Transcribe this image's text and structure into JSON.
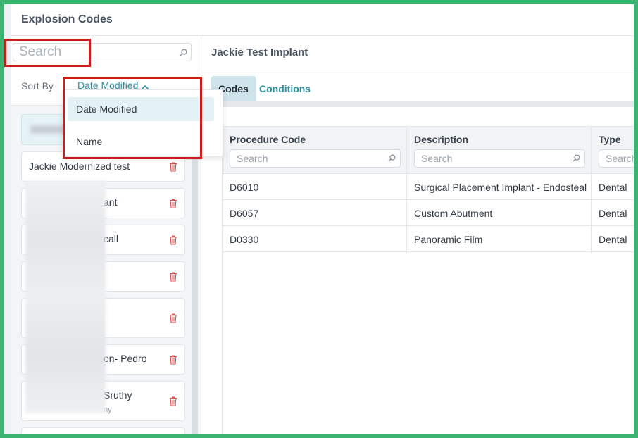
{
  "header": {
    "title": "Explosion Codes"
  },
  "left": {
    "search_placeholder": "Search",
    "sort_label": "Sort By",
    "sort_value": "Date Modified",
    "items": [
      {
        "name": "",
        "sub": "",
        "selected": true
      },
      {
        "name": "Jackie Modernized test",
        "sub": ""
      },
      {
        "name": "ant",
        "sub": ""
      },
      {
        "name": "call",
        "sub": ""
      },
      {
        "name": "",
        "sub": ""
      },
      {
        "name": "",
        "sub": ""
      },
      {
        "name": "on- Pedro",
        "sub": ""
      },
      {
        "name": "Sruthy",
        "sub": "ny"
      },
      {
        "name": "",
        "sub": ""
      }
    ]
  },
  "dropdown": {
    "options": [
      "Date Modified",
      "Name"
    ]
  },
  "right": {
    "title": "Jackie Test Implant",
    "tabs": [
      "Codes",
      "Conditions"
    ],
    "columns": [
      {
        "title": "Procedure Code",
        "placeholder": "Search"
      },
      {
        "title": "Description",
        "placeholder": "Search"
      },
      {
        "title": "Type",
        "placeholder": "Search"
      }
    ],
    "rows": [
      {
        "code": "D6010",
        "description": "Surgical Placement Implant - Endosteal",
        "type": "Dental"
      },
      {
        "code": "D6057",
        "description": "Custom Abutment",
        "type": "Dental"
      },
      {
        "code": "D0330",
        "description": "Panoramic Film",
        "type": "Dental"
      }
    ]
  },
  "colors": {
    "accent": "#2b8fa0",
    "frame": "#3cb371",
    "annotation": "#cc1d1d",
    "trash": "#d9534f"
  },
  "icons": {
    "search": "search-icon",
    "trash": "trash-icon",
    "chevron": "chevron-up-icon"
  }
}
